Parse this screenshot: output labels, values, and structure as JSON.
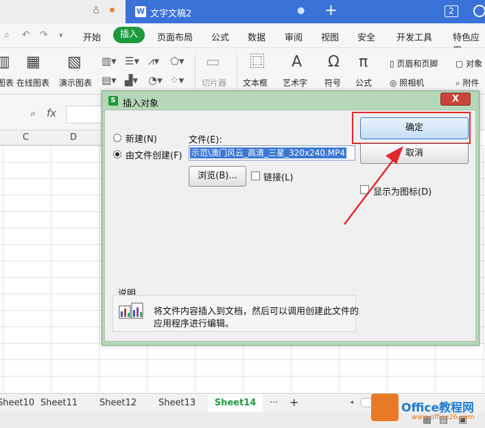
{
  "titlebar": {
    "doc_title": "文字文稿2",
    "doc_icon": "W",
    "new_tab": "+",
    "window_count": "2"
  },
  "menu": {
    "items": [
      "开始",
      "插入",
      "页面布局",
      "公式",
      "数据",
      "审阅",
      "视图",
      "安全",
      "开发工具",
      "特色应用"
    ],
    "active": "插入"
  },
  "ribbon": {
    "left_items": [
      "图表",
      "在线图表",
      "演示图表"
    ],
    "cut_label": "切片器",
    "textbox": "文本框",
    "wordart": "艺术字",
    "symbol": "符号",
    "formula": "公式",
    "header_footer": "页眉和页脚",
    "camera": "照相机",
    "object": "对象",
    "attachment": "附件"
  },
  "formula_bar": {
    "fx": "fx"
  },
  "columns": [
    "C",
    "D"
  ],
  "sheets": {
    "tabs": [
      "Sheet10",
      "Sheet11",
      "Sheet12",
      "Sheet13"
    ],
    "active": "Sheet14",
    "more": "···",
    "add": "+"
  },
  "dialog": {
    "title": "插入对象",
    "close": "X",
    "radio_new": "新建(N)",
    "radio_from_file": "由文件创建(F)",
    "file_label": "文件(E):",
    "file_value": "示范\\澳门风云_高清_三星_320x240.MP4",
    "browse": "浏览(B)...",
    "link": "链接(L)",
    "ok": "确定",
    "cancel": "取消",
    "show_as_icon": "显示为图标(D)",
    "desc_title": "说明",
    "desc_text_line1": "将文件内容插入到文档，然后可以调用创建此文件的",
    "desc_text_line2": "应用程序进行编辑。"
  },
  "watermark": {
    "brand": "Office教程网",
    "url": "www.office26.com"
  },
  "colors": {
    "accent": "#1d9a3e",
    "titlebar": "#3a72d8",
    "highlight": "#e2262b"
  }
}
